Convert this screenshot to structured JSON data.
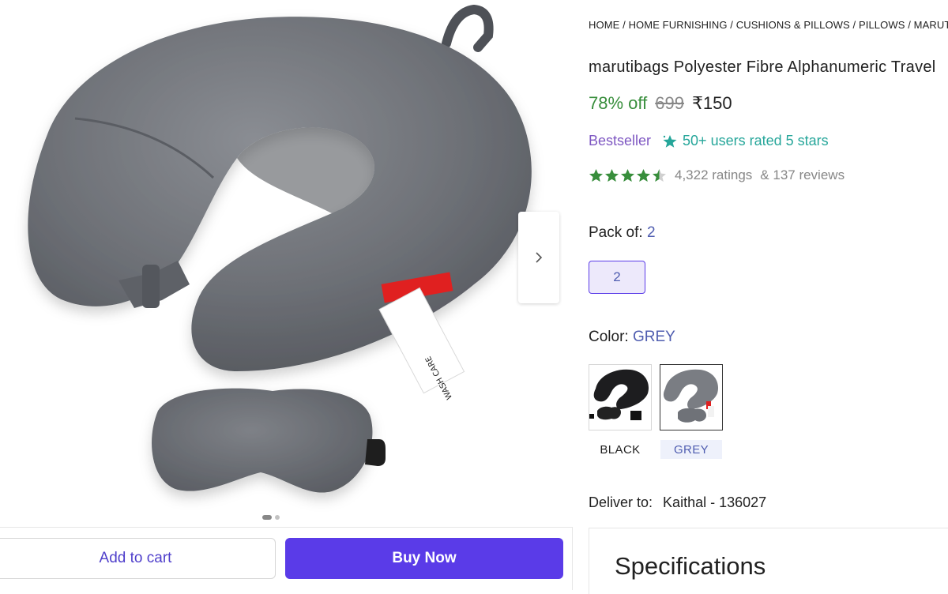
{
  "breadcrumb": {
    "items": [
      "HOME",
      "HOME FURNISHING",
      "CUSHIONS & PILLOWS",
      "PILLOWS",
      "MARUTI"
    ],
    "separator": "/"
  },
  "product": {
    "title": "marutibags Polyester Fibre Alphanumeric Travel",
    "discount": "78% off",
    "mrp": "699",
    "price": "₹150",
    "bestseller_label": "Bestseller",
    "rated_label": "50+ users rated 5 stars",
    "rating_value": 4.5,
    "ratings_count": "4,322 ratings",
    "reviews_count": "& 137 reviews"
  },
  "pack": {
    "label": "Pack of:",
    "selected": "2",
    "options": [
      "2"
    ]
  },
  "color": {
    "label": "Color:",
    "selected": "GREY",
    "options": [
      {
        "name": "BLACK",
        "selected": false
      },
      {
        "name": "GREY",
        "selected": true
      }
    ]
  },
  "delivery": {
    "label": "Deliver to:",
    "location": "Kaithal - 136027"
  },
  "specifications": {
    "title": "Specifications"
  },
  "actions": {
    "add_to_cart": "Add to cart",
    "buy_now": "Buy Now"
  },
  "gallery": {
    "image_count": 2,
    "active_index": 0,
    "next_icon": "chevron-right-icon"
  },
  "colors": {
    "accent": "#5a3be8",
    "discount_green": "#388e3c",
    "star_green": "#388e3c",
    "bestseller_purple": "#7e57c2",
    "rated_teal": "#26a69a",
    "pillow_grey": "#6f7278"
  },
  "wash_tag": {
    "text": "WASH CARE"
  }
}
